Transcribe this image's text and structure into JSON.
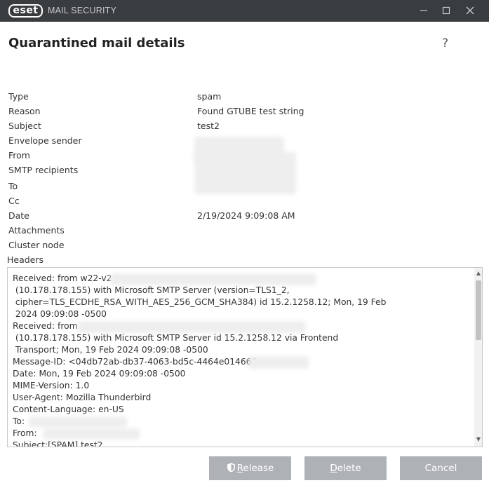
{
  "titlebar": {
    "logo": "eset",
    "app_name": "MAIL SECURITY",
    "minimize_icon": "minimize-icon",
    "maximize_icon": "maximize-icon",
    "close_icon": "close-icon"
  },
  "page": {
    "title": "Quarantined mail details",
    "help": "?"
  },
  "details": [
    {
      "label": "Type",
      "value": "spam"
    },
    {
      "label": "Reason",
      "value": "Found GTUBE test string"
    },
    {
      "label": "Subject",
      "value": "test2"
    },
    {
      "label": "Envelope sender",
      "value": ""
    },
    {
      "label": "From",
      "value": ""
    },
    {
      "label": "SMTP recipients",
      "value": ""
    },
    {
      "label": "To",
      "value": ""
    },
    {
      "label": "Cc",
      "value": ""
    },
    {
      "label": "Date",
      "value": "2/19/2024 9:09:08 AM"
    },
    {
      "label": "Attachments",
      "value": ""
    },
    {
      "label": "Cluster node",
      "value": ""
    }
  ],
  "headers": {
    "label": "Headers",
    "lines": [
      "Received: from w22-v2",
      " (10.178.178.155) with Microsoft SMTP Server (version=TLS1_2,",
      " cipher=TLS_ECDHE_RSA_WITH_AES_256_GCM_SHA384) id 15.2.1258.12; Mon, 19 Feb",
      " 2024 09:09:08 -0500",
      "Received: from",
      " (10.178.178.155) with Microsoft SMTP Server id 15.2.1258.12 via Frontend",
      " Transport; Mon, 19 Feb 2024 09:09:08 -0500",
      "Message-ID: <04db72ab-db37-4063-bd5c-4464e014662",
      "Date: Mon, 19 Feb 2024 09:09:08 -0500",
      "MIME-Version: 1.0",
      "User-Agent: Mozilla Thunderbird",
      "Content-Language: en-US",
      "To:",
      "From:",
      "Subject:[SPAM] test2"
    ]
  },
  "buttons": {
    "release_prefix": "",
    "release_underlined": "R",
    "release_rest": "elease",
    "delete_underlined": "D",
    "delete_rest": "elete",
    "cancel": "Cancel"
  },
  "colors": {
    "titlebar": "#3a3d40",
    "button": "#aeb2b6"
  }
}
